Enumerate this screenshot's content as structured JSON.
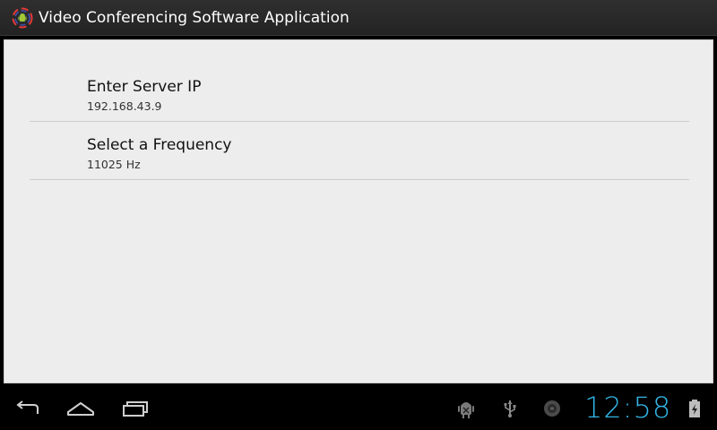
{
  "app": {
    "title": "Video Conferencing Software Application",
    "icon": "android-app-icon"
  },
  "preferences": [
    {
      "title": "Enter Server IP",
      "summary": "192.168.43.9"
    },
    {
      "title": "Select a Frequency",
      "summary": "11025 Hz"
    }
  ],
  "system_bar": {
    "clock": "12:58",
    "clock_color": "#33b5e5",
    "nav_icons": [
      "back-icon",
      "home-icon",
      "recent-apps-icon"
    ],
    "status_icons": [
      "android-debug-icon",
      "usb-icon",
      "record-icon",
      "battery-charging-icon"
    ]
  },
  "colors": {
    "title_bar": "#2a2a2a",
    "content_background": "#ededed",
    "divider": "#cccccc",
    "accent": "#33b5e5"
  }
}
